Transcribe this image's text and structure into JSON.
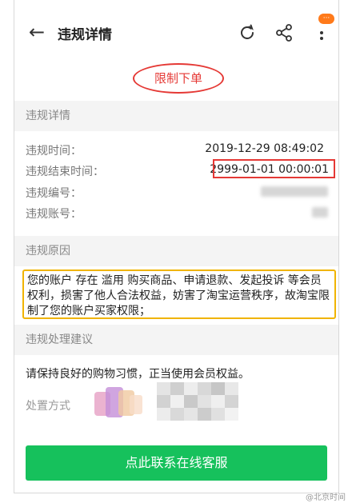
{
  "header": {
    "back_icon": "arrow-left-icon",
    "title": "违规详情",
    "badge": "···",
    "icons": [
      "refresh-icon",
      "share-icon",
      "more-vertical-icon"
    ]
  },
  "status_pill": "限制下单",
  "details": {
    "section_title": "违规详情",
    "rows": [
      {
        "label": "违规时间：",
        "value": "2019-12-29 08:49:02"
      },
      {
        "label": "违规结束时间：",
        "value": "2999-01-01 00:00:01"
      },
      {
        "label": "违规编号：",
        "value": ""
      },
      {
        "label": "违规账号：",
        "value": ""
      }
    ]
  },
  "reason": {
    "section_title": "违规原因",
    "text": "您的账户 存在 滥用 购买商品、申请退款、发起投诉 等会员权利，损害了他人合法权益，妨害了淘宝运营秩序，故淘宝限制了您的账户买家权限；"
  },
  "advice": {
    "section_title": "违规处理建议",
    "text": "请保持良好的购物习惯，正当使用会员权益。",
    "method_label": "处置方式"
  },
  "cta": {
    "label": "点此联系在线客服"
  },
  "watermark": "@北京时间",
  "colors": {
    "accent_red": "#e53935",
    "cta_green": "#16c15c",
    "highlight_yellow": "#f0b400",
    "badge_orange": "#ff7a1a"
  }
}
